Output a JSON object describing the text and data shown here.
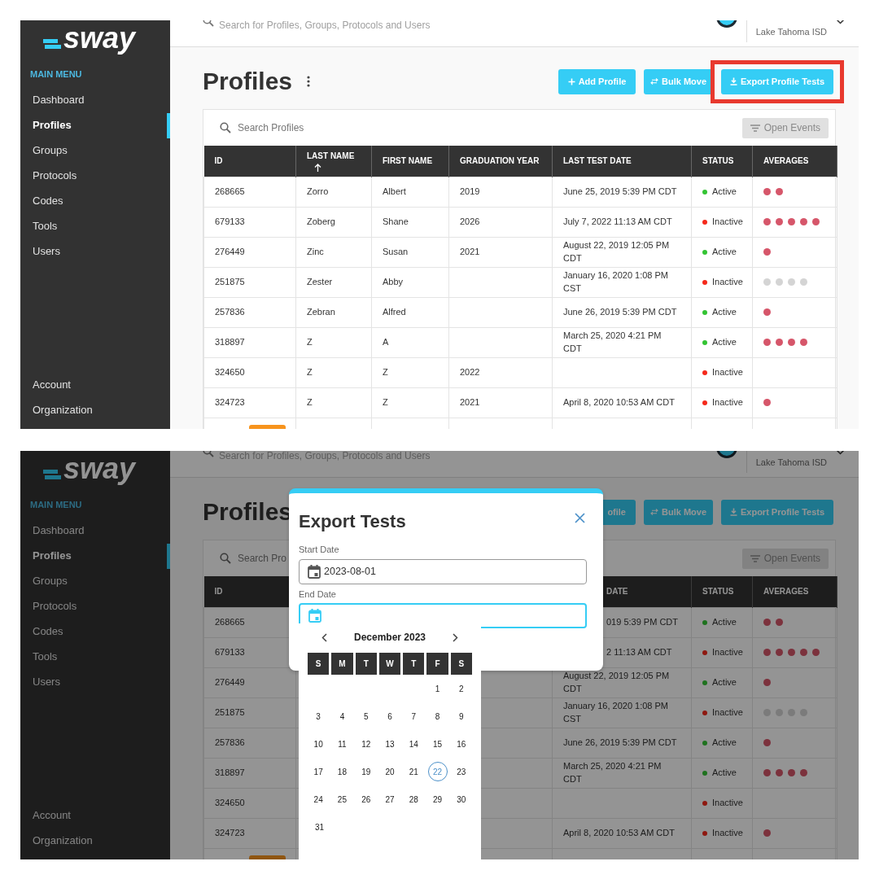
{
  "screens": [
    {
      "sidebar": {
        "logo": "sway",
        "heading": "MAIN MENU",
        "items": [
          {
            "label": "Dashboard",
            "selected": false
          },
          {
            "label": "Profiles",
            "selected": true
          },
          {
            "label": "Groups",
            "selected": false
          },
          {
            "label": "Protocols",
            "selected": false
          },
          {
            "label": "Codes",
            "selected": false
          },
          {
            "label": "Tools",
            "selected": false
          },
          {
            "label": "Users",
            "selected": false
          }
        ],
        "footer_items": [
          {
            "label": "Account"
          },
          {
            "label": "Organization"
          }
        ]
      },
      "header": {
        "search_placeholder": "Search for Profiles, Groups, Protocols and Users",
        "organization": "Lake Tahoma ISD"
      },
      "page_title": "Profiles",
      "buttons": [
        {
          "label": "Add Profile",
          "highlighted": false
        },
        {
          "label": "Bulk Move",
          "highlighted": false
        },
        {
          "label": "Export Profile Tests",
          "highlighted": true
        }
      ],
      "search": {
        "placeholder": "Search Profiles"
      },
      "filter_button": "Open Events",
      "table": {
        "columns": [
          {
            "label": "ID"
          },
          {
            "label": "LAST NAME",
            "sorted": true
          },
          {
            "label": "FIRST NAME"
          },
          {
            "label": "GRADUATION YEAR"
          },
          {
            "label": "LAST TEST DATE"
          },
          {
            "label": "STATUS"
          },
          {
            "label": "AVERAGES"
          }
        ],
        "rows": [
          {
            "cells": [
              "268665",
              "Zorro",
              "Albert",
              "2019",
              "June 25, 2019 5:39 PM CDT"
            ],
            "status": {
              "label": "Active",
              "color": "#33c433"
            },
            "averages": [
              {
                "color": "#d6566a"
              },
              {
                "color": "#d6566a"
              }
            ]
          },
          {
            "cells": [
              "679133",
              "Zoberg",
              "Shane",
              "2026",
              "July 7, 2022 11:13 AM CDT"
            ],
            "status": {
              "label": "Inactive",
              "color": "#f5291b"
            },
            "averages": [
              {
                "color": "#d6566a"
              },
              {
                "color": "#d6566a"
              },
              {
                "color": "#d6566a"
              },
              {
                "color": "#d6566a"
              },
              {
                "color": "#d6566a"
              }
            ]
          },
          {
            "cells": [
              "276449",
              "Zinc",
              "Susan",
              "2021",
              "August 22, 2019 12:05 PM CDT"
            ],
            "status": {
              "label": "Active",
              "color": "#33c433"
            },
            "averages": [
              {
                "color": "#d6566a"
              }
            ]
          },
          {
            "cells": [
              "251875",
              "Zester",
              "Abby",
              null,
              "January 16, 2020 1:08 PM CST"
            ],
            "status": {
              "label": "Inactive",
              "color": "#f5291b"
            },
            "averages": [
              {
                "color": "#d4d4d4"
              },
              {
                "color": "#d4d4d4"
              },
              {
                "color": "#d4d4d4"
              },
              {
                "color": "#d4d4d4"
              }
            ]
          },
          {
            "cells": [
              "257836",
              "Zebran",
              "Alfred",
              null,
              "June 26, 2019 5:39 PM CDT"
            ],
            "status": {
              "label": "Active",
              "color": "#33c433"
            },
            "averages": [
              {
                "color": "#d6566a"
              }
            ]
          },
          {
            "cells": [
              "318897",
              "Z",
              "A",
              null,
              "March 25, 2020 4:21 PM CDT"
            ],
            "status": {
              "label": "Active",
              "color": "#33c433"
            },
            "averages": [
              {
                "color": "#d6566a"
              },
              {
                "color": "#d6566a"
              },
              {
                "color": "#d6566a"
              },
              {
                "color": "#d6566a"
              }
            ]
          },
          {
            "cells": [
              "324650",
              "Z",
              "Z",
              "2022",
              null
            ],
            "status": {
              "label": "Inactive",
              "color": "#f5291b"
            }
          },
          {
            "cells": [
              "324723",
              "Z",
              "Z",
              "2021",
              "April 8, 2020 10:53 AM CDT"
            ],
            "status": {
              "label": "Inactive",
              "color": "#f5291b"
            },
            "averages": [
              {
                "color": "#d6566a"
              }
            ]
          },
          {
            "tag": {
              "color": "#f7941d"
            }
          }
        ]
      }
    },
    {
      "sidebar": {
        "logo": "sway",
        "heading": "MAIN MENU",
        "items": [
          {
            "label": "Dashboard",
            "selected": false
          },
          {
            "label": "Profiles",
            "selected": true
          },
          {
            "label": "Groups",
            "selected": false
          },
          {
            "label": "Protocols",
            "selected": false
          },
          {
            "label": "Codes",
            "selected": false
          },
          {
            "label": "Tools",
            "selected": false
          },
          {
            "label": "Users",
            "selected": false
          }
        ],
        "footer_items": [
          {
            "label": "Account"
          },
          {
            "label": "Organization"
          }
        ]
      },
      "header": {
        "search_placeholder": "Search for Profiles, Groups, Protocols and Users",
        "organization": "Lake Tahoma ISD"
      },
      "page_title": "Profiles",
      "buttons": [
        {
          "label": "ofile",
          "cut_left": true,
          "highlighted": false
        },
        {
          "label": "Bulk Move",
          "highlighted": false
        },
        {
          "label": "Export Profile Tests",
          "highlighted": false
        }
      ],
      "search": {
        "placeholder": "Search Pro"
      },
      "filter_button": "Open Events",
      "table": {
        "columns": [
          {
            "label": "ID"
          },
          null,
          null,
          null,
          {
            "label": "DATE",
            "cut_left": true
          },
          {
            "label": "STATUS"
          },
          {
            "label": "AVERAGES"
          }
        ],
        "rows": [
          {
            "cells": [
              "268665",
              null,
              null,
              null,
              {
                "text": "019 5:39 PM CDT",
                "cut_left": true
              }
            ],
            "status": {
              "label": "Active",
              "color": "#1e721e"
            },
            "averages": [
              {
                "color": "#7c323d"
              },
              {
                "color": "#7c323d"
              }
            ]
          },
          {
            "cells": [
              "679133",
              null,
              null,
              null,
              {
                "text": "2 11:13 AM CDT",
                "cut_left": true
              }
            ],
            "status": {
              "label": "Inactive",
              "color": "#8e1810"
            },
            "averages": [
              {
                "color": "#7c323d"
              },
              {
                "color": "#7c323d"
              },
              {
                "color": "#7c323d"
              },
              {
                "color": "#7c323d"
              },
              {
                "color": "#7c323d"
              }
            ]
          },
          {
            "cells": [
              "276449",
              null,
              null,
              null,
              "August 22, 2019 12:05 PM CDT"
            ],
            "status": {
              "label": "Active",
              "color": "#1e721e"
            },
            "averages": [
              {
                "color": "#7c323d"
              }
            ]
          },
          {
            "cells": [
              "251875",
              null,
              null,
              null,
              "January 16, 2020 1:08 PM CST"
            ],
            "status": {
              "label": "Inactive",
              "color": "#8e1810"
            },
            "averages": [
              {
                "color": "#7b7b7b"
              },
              {
                "color": "#7b7b7b"
              },
              {
                "color": "#7b7b7b"
              },
              {
                "color": "#7b7b7b"
              }
            ]
          },
          {
            "cells": [
              "257836",
              null,
              null,
              null,
              "June 26, 2019 5:39 PM CDT"
            ],
            "status": {
              "label": "Active",
              "color": "#1e721e"
            },
            "averages": [
              {
                "color": "#7c323d"
              }
            ]
          },
          {
            "cells": [
              "318897",
              null,
              null,
              null,
              "March 25, 2020 4:21 PM CDT"
            ],
            "status": {
              "label": "Active",
              "color": "#1e721e"
            },
            "averages": [
              {
                "color": "#7c323d"
              },
              {
                "color": "#7c323d"
              },
              {
                "color": "#7c323d"
              },
              {
                "color": "#7c323d"
              }
            ]
          },
          {
            "cells": [
              "324650",
              null,
              null,
              null,
              null
            ],
            "status": {
              "label": "Inactive",
              "color": "#8e1810"
            }
          },
          {
            "cells": [
              "324723",
              null,
              null,
              null,
              "April 8, 2020 10:53 AM CDT"
            ],
            "status": {
              "label": "Inactive",
              "color": "#8e1810"
            },
            "averages": [
              {
                "color": "#7c323d"
              }
            ]
          },
          {
            "tag": {
              "color": "#8f5611"
            }
          }
        ]
      },
      "modal": {
        "title": "Export Tests",
        "fields": [
          {
            "label": "Start Date",
            "value": "2023-08-01",
            "focused": false
          },
          {
            "label": "End Date",
            "focused": true
          }
        ],
        "calendar": {
          "month": "December 2023",
          "weekdays": [
            "S",
            "M",
            "T",
            "W",
            "T",
            "F",
            "S"
          ],
          "weeks": [
            {
              "days": [
                {
                  "label": "1",
                  "selected": false
                },
                {
                  "label": "2",
                  "selected": false
                }
              ]
            },
            {
              "days": [
                {
                  "label": "3",
                  "selected": false
                },
                {
                  "label": "4",
                  "selected": false
                },
                {
                  "label": "5",
                  "selected": false
                },
                {
                  "label": "6",
                  "selected": false
                },
                {
                  "label": "7",
                  "selected": false
                },
                {
                  "label": "8",
                  "selected": false
                },
                {
                  "label": "9",
                  "selected": false
                }
              ]
            },
            {
              "days": [
                {
                  "label": "10",
                  "selected": false
                },
                {
                  "label": "11",
                  "selected": false
                },
                {
                  "label": "12",
                  "selected": false
                },
                {
                  "label": "13",
                  "selected": false
                },
                {
                  "label": "14",
                  "selected": false
                },
                {
                  "label": "15",
                  "selected": false
                },
                {
                  "label": "16",
                  "selected": false
                }
              ]
            },
            {
              "days": [
                {
                  "label": "17",
                  "selected": false
                },
                {
                  "label": "18",
                  "selected": false
                },
                {
                  "label": "19",
                  "selected": false
                },
                {
                  "label": "20",
                  "selected": false
                },
                {
                  "label": "21",
                  "selected": false
                },
                {
                  "label": "22",
                  "selected": true
                },
                {
                  "label": "23",
                  "selected": false
                }
              ]
            },
            {
              "days": [
                {
                  "label": "24",
                  "selected": false
                },
                {
                  "label": "25",
                  "selected": false
                },
                {
                  "label": "26",
                  "selected": false
                },
                {
                  "label": "27",
                  "selected": false
                },
                {
                  "label": "28",
                  "selected": false
                },
                {
                  "label": "29",
                  "selected": false
                },
                {
                  "label": "30",
                  "selected": false
                }
              ]
            },
            {
              "days": [
                {
                  "label": "31",
                  "selected": false
                }
              ]
            }
          ]
        }
      }
    }
  ]
}
